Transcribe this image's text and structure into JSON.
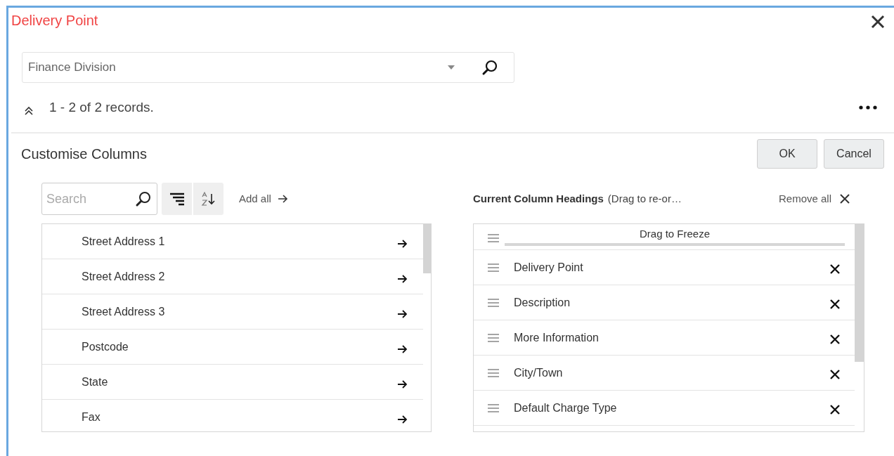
{
  "dialog": {
    "title": "Delivery Point"
  },
  "filter": {
    "value": "Finance Division"
  },
  "records": "1 - 2 of 2 records.",
  "panel": {
    "title": "Customise Columns",
    "buttons": [
      "OK",
      "Cancel"
    ]
  },
  "available": {
    "search_placeholder": "Search",
    "add_all": "Add all",
    "items": [
      {
        "label": "Street Address 1"
      },
      {
        "label": "Street Address 2"
      },
      {
        "label": "Street Address 3"
      },
      {
        "label": "Postcode"
      },
      {
        "label": "State"
      },
      {
        "label": "Fax"
      }
    ]
  },
  "current": {
    "heading": "Current Column Headings",
    "hint": "(Drag to re-or…",
    "remove_all": "Remove all",
    "freeze_label": "Drag to Freeze",
    "items": [
      {
        "label": "Delivery Point"
      },
      {
        "label": "Description"
      },
      {
        "label": "More Information"
      },
      {
        "label": "City/Town"
      },
      {
        "label": "Default Charge Type"
      }
    ]
  }
}
